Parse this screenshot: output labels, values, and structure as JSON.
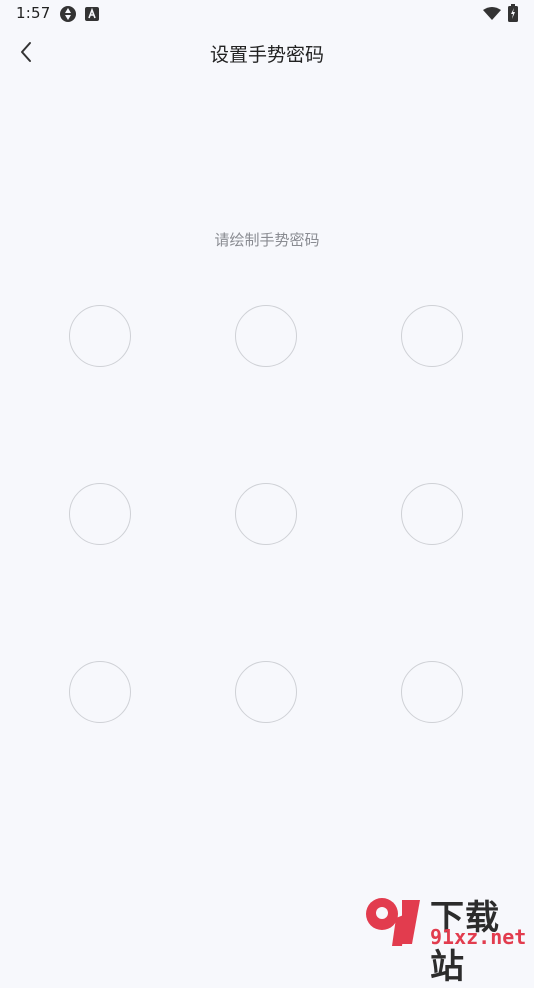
{
  "status_bar": {
    "time": "1:57",
    "icons": [
      "aperture-icon",
      "font-a-icon",
      "wifi-icon",
      "battery-charging-icon"
    ]
  },
  "header": {
    "title": "设置手势密码",
    "back_icon": "chevron-left-icon"
  },
  "hint": "请绘制手势密码",
  "pattern": {
    "rows": 3,
    "cols": 3,
    "dot_border_color": "#cfd1d6"
  },
  "watermark": {
    "top_text": "下载站",
    "bottom_text": "91xz.net",
    "logo_color": "#e23c4e"
  },
  "colors": {
    "background": "#f7f8fc",
    "hint_text": "#8a8c92"
  }
}
